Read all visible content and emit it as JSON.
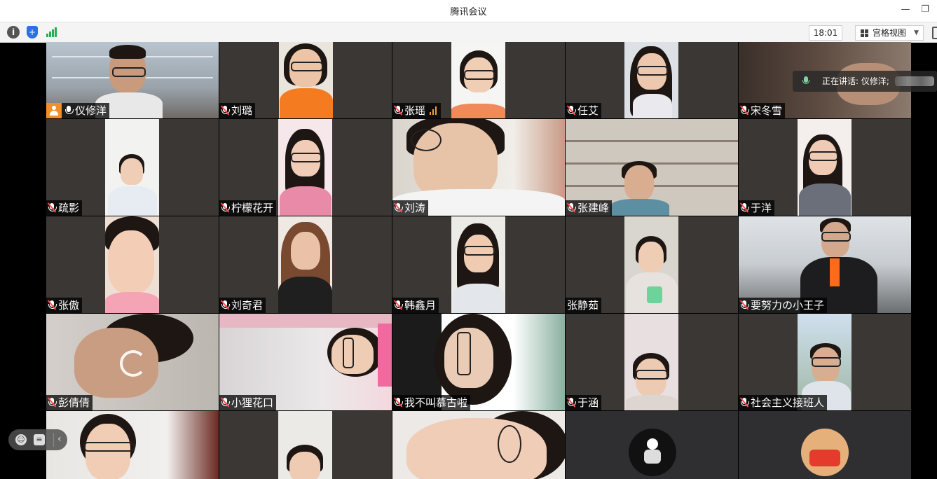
{
  "window": {
    "title": "腾讯会议",
    "minimize": "—",
    "restore": "❐"
  },
  "toolbar": {
    "info": "i",
    "shield": "+",
    "time": "18:01",
    "view_label": "宫格视图",
    "view_caret": "▼"
  },
  "speaking": {
    "label": "正在讲话: 仪修洋;"
  },
  "participants": [
    {
      "name": "仪修洋",
      "mic": "on",
      "host": true,
      "active": true
    },
    {
      "name": "刘璐",
      "mic": "muted"
    },
    {
      "name": "张瑶",
      "mic": "muted",
      "signal": true
    },
    {
      "name": "任艾",
      "mic": "muted"
    },
    {
      "name": "宋冬雪",
      "mic": "muted"
    },
    {
      "name": "疏影",
      "mic": "muted"
    },
    {
      "name": "柠檬花开",
      "mic": "muted"
    },
    {
      "name": "刘涛",
      "mic": "muted"
    },
    {
      "name": "张建峰",
      "mic": "muted"
    },
    {
      "name": "于洋",
      "mic": "muted"
    },
    {
      "name": "张傲",
      "mic": "muted"
    },
    {
      "name": "刘奇君",
      "mic": "muted"
    },
    {
      "name": "韩鑫月",
      "mic": "muted"
    },
    {
      "name": "张静茹",
      "mic": "none"
    },
    {
      "name": "要努力の小王子",
      "mic": "muted"
    },
    {
      "name": "彭倩倩",
      "mic": "muted",
      "loading": true
    },
    {
      "name": "小狸花口",
      "mic": "muted"
    },
    {
      "name": "我不叫慕古啦",
      "mic": "muted"
    },
    {
      "name": "于涵",
      "mic": "muted"
    },
    {
      "name": "社会主义接班人",
      "mic": "muted"
    },
    {
      "name": "",
      "mic": "none"
    },
    {
      "name": "",
      "mic": "none"
    },
    {
      "name": "",
      "mic": "none"
    },
    {
      "name": "",
      "mic": "none"
    },
    {
      "name": "",
      "mic": "none"
    }
  ],
  "chat": {
    "emoji": "☺",
    "comment": "≡",
    "collapse": "‹"
  }
}
